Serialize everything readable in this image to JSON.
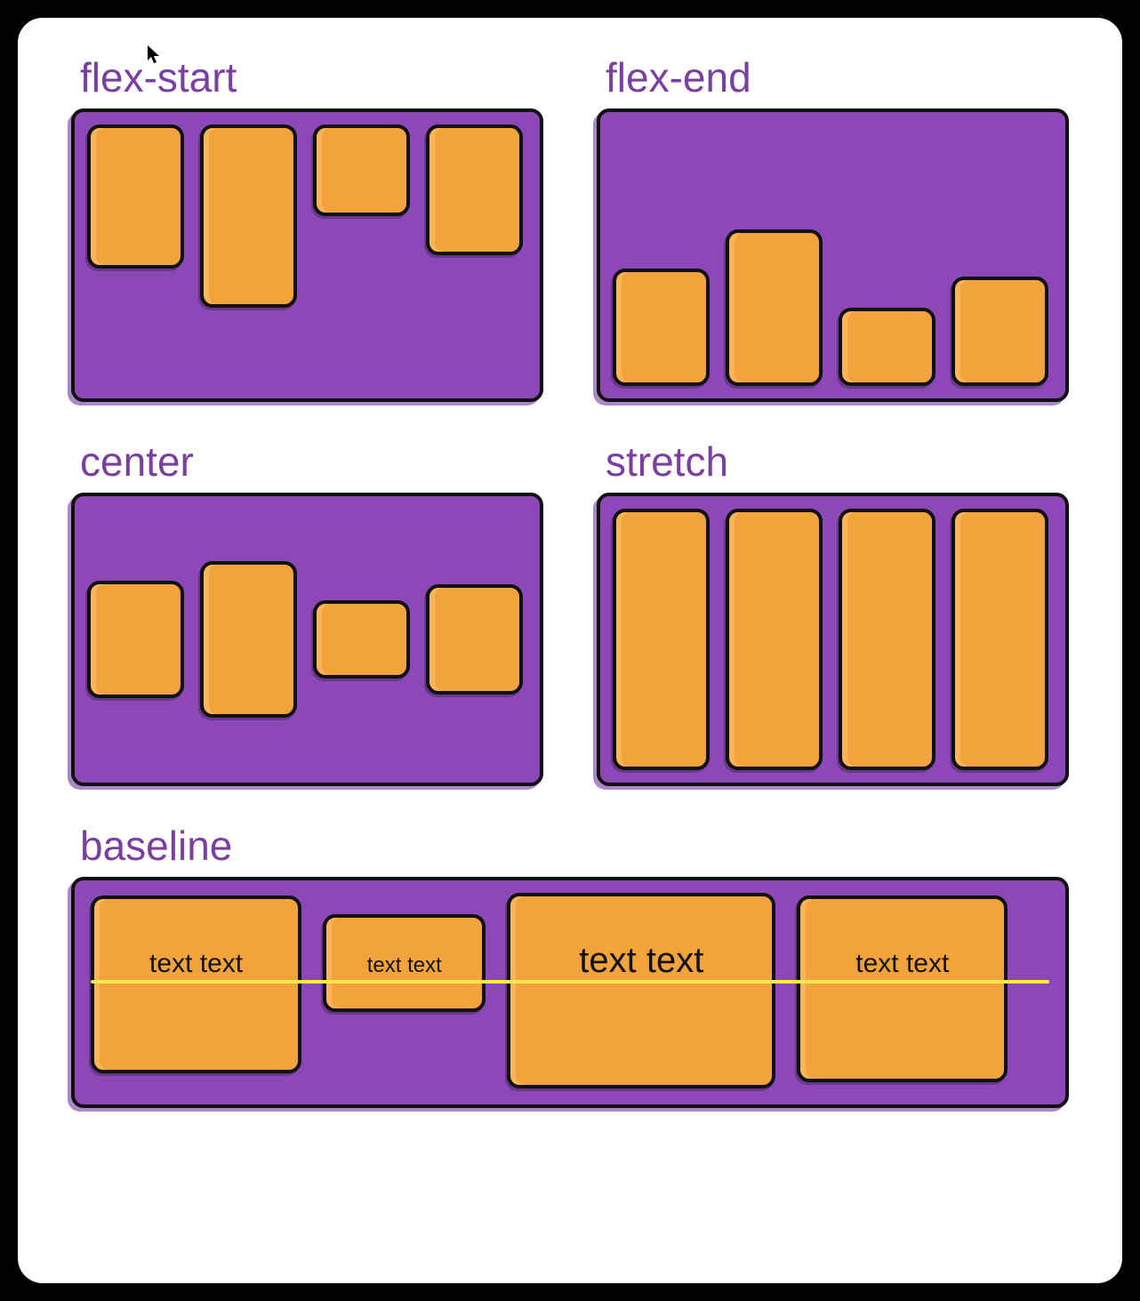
{
  "panels": {
    "flex_start": {
      "label": "flex-start"
    },
    "flex_end": {
      "label": "flex-end"
    },
    "center": {
      "label": "center"
    },
    "stretch": {
      "label": "stretch"
    },
    "baseline": {
      "label": "baseline"
    }
  },
  "baseline_items": {
    "t1": "text text",
    "t2": "text text",
    "t3": "text text",
    "t4": "text text"
  },
  "colors": {
    "container": "#8d48b8",
    "item": "#f2a33c",
    "label": "#7b3fa0",
    "baseline_line": "#ffe94a"
  },
  "cursor_glyph": "↖"
}
